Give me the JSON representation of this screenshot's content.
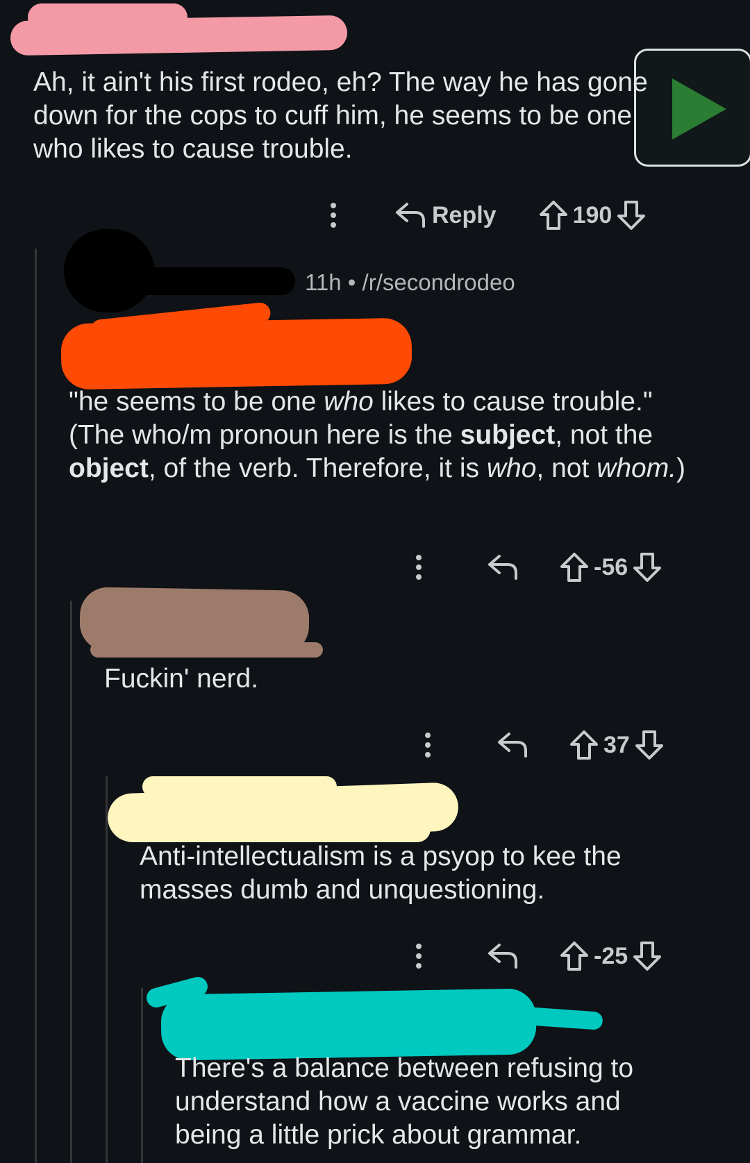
{
  "comments": [
    {
      "text": "Ah, it ain't his first rodeo, eh? The way he has gone down for the cops to cuff him, he seems to be one who likes to cause trouble.",
      "reply_label": "Reply",
      "score": "190"
    },
    {
      "meta": {
        "time": "11h",
        "separator": "•",
        "subreddit": "/r/secondrodeo"
      },
      "quote_open": "\"he seems to be one ",
      "quote_italic": "who",
      "quote_close": " likes to cause trouble.\"",
      "explanation_1": "(The who/m pronoun here is the ",
      "explanation_bold_1": "subject",
      "explanation_2": ", not the ",
      "explanation_bold_2": "object",
      "explanation_3": ", of the verb. Therefore, it is ",
      "explanation_italic_1": "who",
      "explanation_4": ", not ",
      "explanation_italic_2": "whom.",
      "explanation_5": ")",
      "score": "-56"
    },
    {
      "text": "Fuckin' nerd.",
      "score": "37"
    },
    {
      "text": "Anti-intellectualism is a psyop to kee the masses dumb and unquestioning.",
      "score": "-25"
    },
    {
      "text": "There's a balance between refusing to understand how a vaccine works and being a little prick about grammar."
    }
  ],
  "redaction_colors": [
    "#f49aa6",
    "#000000",
    "#fd4a05",
    "#9d7b6b",
    "#fff6bf",
    "#00c9c0"
  ],
  "icons": [
    "more-options-icon",
    "reply-arrow-icon",
    "upvote-arrow-icon",
    "downvote-arrow-icon",
    "play-icon"
  ]
}
